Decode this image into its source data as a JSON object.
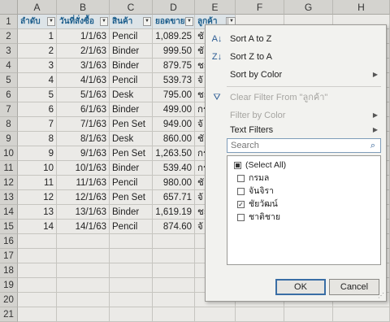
{
  "columns": [
    "A",
    "B",
    "C",
    "D",
    "E",
    "F",
    "G",
    "H"
  ],
  "row_numbers": [
    "1",
    "2",
    "3",
    "4",
    "5",
    "6",
    "7",
    "8",
    "9",
    "10",
    "11",
    "12",
    "13",
    "14",
    "15",
    "16",
    "17",
    "18",
    "19",
    "20",
    "21"
  ],
  "headers": [
    "ลำดับ",
    "วันที่สั่งซื้อ",
    "สินค้า",
    "ยอดขาย",
    "ลูกค้า"
  ],
  "rows": [
    [
      "1",
      "1/1/63",
      "Pencil",
      "1,089.25",
      "ชั"
    ],
    [
      "2",
      "2/1/63",
      "Binder",
      "999.50",
      "ชั"
    ],
    [
      "3",
      "3/1/63",
      "Binder",
      "879.75",
      "ชะ"
    ],
    [
      "4",
      "4/1/63",
      "Pencil",
      "539.73",
      "จั"
    ],
    [
      "5",
      "5/1/63",
      "Desk",
      "795.00",
      "ชะ"
    ],
    [
      "6",
      "6/1/63",
      "Binder",
      "499.00",
      "กร"
    ],
    [
      "7",
      "7/1/63",
      "Pen Set",
      "949.00",
      "จั"
    ],
    [
      "8",
      "8/1/63",
      "Desk",
      "860.00",
      "ชั"
    ],
    [
      "9",
      "9/1/63",
      "Pen Set",
      "1,263.50",
      "กร"
    ],
    [
      "10",
      "10/1/63",
      "Binder",
      "539.40",
      "กร"
    ],
    [
      "11",
      "11/1/63",
      "Pencil",
      "980.00",
      "ชั"
    ],
    [
      "12",
      "12/1/63",
      "Pen Set",
      "657.71",
      "จั"
    ],
    [
      "13",
      "13/1/63",
      "Binder",
      "1,619.19",
      "ชะ"
    ],
    [
      "14",
      "14/1/63",
      "Pencil",
      "874.60",
      "จั"
    ]
  ],
  "menu": {
    "sort_az": "Sort A to Z",
    "sort_za": "Sort Z to A",
    "sort_color": "Sort by Color",
    "clear_filter": "Clear Filter From \"ลูกค้า\"",
    "filter_color": "Filter by Color",
    "text_filters": "Text Filters",
    "search_placeholder": "Search",
    "items": [
      {
        "label": "(Select All)",
        "state": "partial"
      },
      {
        "label": "กรมล",
        "state": "unchecked"
      },
      {
        "label": "จันจิรา",
        "state": "unchecked"
      },
      {
        "label": "ชัยวัฒน์",
        "state": "checked"
      },
      {
        "label": "ชาติชาย",
        "state": "unchecked"
      }
    ],
    "ok": "OK",
    "cancel": "Cancel"
  },
  "icons": {
    "sort_az": "sort-ascending-icon",
    "sort_za": "sort-descending-icon",
    "clear": "clear-filter-icon",
    "search": "search-icon"
  }
}
